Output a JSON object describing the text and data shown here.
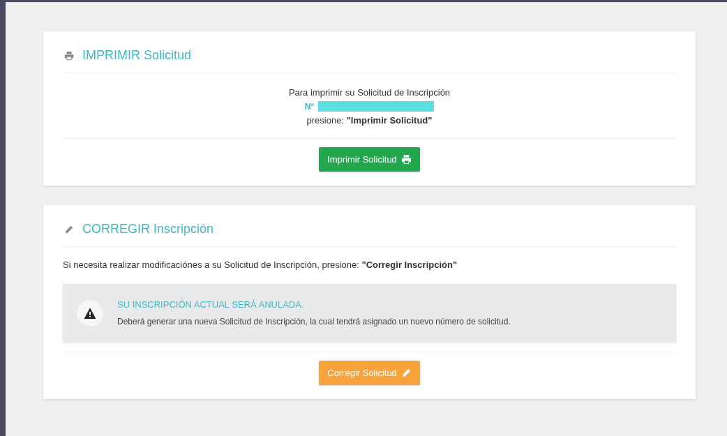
{
  "print_card": {
    "title": "IMPRIMIR Solicitud",
    "intro": "Para imprimir su Solicitud de Inscripción",
    "number_label": "N°",
    "instruction": "presione: **\"Imprimir Solicitud\"**",
    "button": "Imprimir Solicitud"
  },
  "correct_card": {
    "title": "CORREGIR Inscripción",
    "intro": "Si necesita realizar modificaciónes a su Solicitud de Inscripción, presione: **\"Corregir Inscripción\"**",
    "alert": {
      "title": "SU INSCRIPCIÓN ACTUAL SERÁ ANULADA.",
      "message": "Deberá generar una nueva Solicitud de Inscripción, la cual tendrá asignado un nuevo número de solicitud."
    },
    "button": "Corregir Solicitud"
  }
}
